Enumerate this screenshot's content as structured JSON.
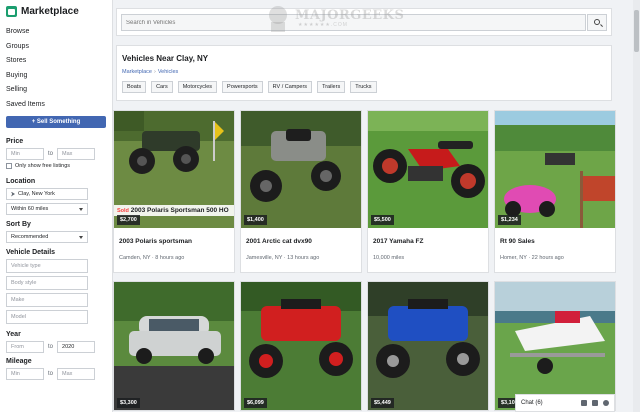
{
  "sidebar": {
    "title": "Marketplace",
    "nav": [
      "Browse",
      "Groups",
      "Stores",
      "Buying",
      "Selling",
      "Saved Items"
    ],
    "sell_label": "+ Sell Something",
    "price": {
      "title": "Price",
      "min_placeholder": "Min",
      "to": "to",
      "max_placeholder": "Max",
      "free_label": "Only show free listings"
    },
    "location": {
      "title": "Location",
      "place": "Clay, New York",
      "radius": "Within 60 miles"
    },
    "sort": {
      "title": "Sort By",
      "value": "Recommended"
    },
    "details": {
      "title": "Vehicle Details",
      "fields": [
        "Vehicle type",
        "Body style",
        "Make",
        "Model"
      ]
    },
    "year": {
      "title": "Year",
      "from": "From",
      "to_label": "to",
      "to_value": "2020"
    },
    "mileage": {
      "title": "Mileage",
      "min": "Min",
      "to": "to",
      "max": "Max"
    }
  },
  "search": {
    "placeholder": "Search in Vehicles"
  },
  "header": {
    "title": "Vehicles Near Clay, NY",
    "crumb_root": "Marketplace",
    "crumb_sep": "›",
    "crumb_current": "Vehicles",
    "chips": [
      "Boats",
      "Cars",
      "Motorcycles",
      "Powersports",
      "RV / Campers",
      "Trailers",
      "Trucks"
    ]
  },
  "listings": [
    {
      "price": "$2,700",
      "sold_tag": "Sold",
      "sold_title": "2003 Polaris Sportsman 500 HO",
      "title": "2003 Polaris sportsman",
      "meta": "Camden, NY · 8 hours ago"
    },
    {
      "price": "$1,400",
      "title": "2001 Arctic cat dvx90",
      "meta": "Jamesville, NY · 13 hours ago"
    },
    {
      "price": "$5,500",
      "title": "2017 Yamaha FZ",
      "meta": "10,000 miles"
    },
    {
      "price": "$1,234",
      "title": "Rt 90 Sales",
      "meta": "Homer, NY · 22 hours ago"
    },
    {
      "price": "$3,300"
    },
    {
      "price": "$6,099"
    },
    {
      "price": "$5,449"
    },
    {
      "price": "$3,100"
    }
  ],
  "watermark": {
    "text": "MAJORGEEKS",
    "stars": "★★★★★★.COM"
  },
  "chat": {
    "label": "Chat (6)"
  },
  "colors": {
    "accent": "#4267b2",
    "sold": "#fa3e3e",
    "brand": "#1b9e6f"
  }
}
